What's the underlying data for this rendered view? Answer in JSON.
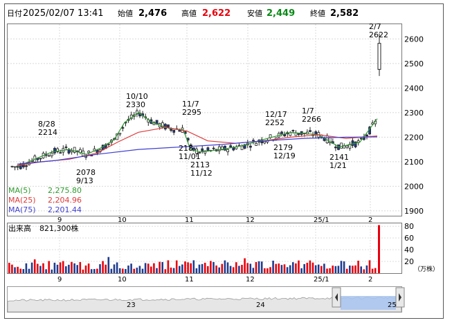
{
  "header": {
    "date_label": "日付",
    "datetime": "2025/02/07 13:41",
    "open_label": "始値",
    "open_value": "2,476",
    "high_label": "高値",
    "high_value": "2,622",
    "low_label": "安値",
    "low_value": "2,449",
    "close_label": "終値",
    "close_value": "2,582"
  },
  "colors": {
    "high": "#e8000b",
    "low": "#0a8a17",
    "up_candle": "#ffffff",
    "down_candle": "#1f3b8f",
    "ma5": "#2f9a2f",
    "ma25": "#e03a3a",
    "ma75": "#3f3fd0",
    "vol_up": "#e8000b",
    "vol_down": "#1f3b8f"
  },
  "legend": [
    {
      "name": "MA(5)",
      "value": "2,275.80",
      "color": "#2f9a2f"
    },
    {
      "name": "MA(25)",
      "value": "2,204.96",
      "color": "#e03a3a"
    },
    {
      "name": "MA(75)",
      "value": "2,201.44",
      "color": "#3f3fd0"
    }
  ],
  "chart_data": [
    {
      "type": "line",
      "name": "price",
      "ylim": [
        1880,
        2660
      ],
      "yticks": [
        "1900",
        "2000",
        "2100",
        "2200",
        "2300",
        "2400",
        "2500",
        "2600"
      ],
      "xticks": [
        "9",
        "10",
        "11",
        "12",
        "25/1",
        "2"
      ],
      "annotations": [
        {
          "date": "8/28",
          "value": "2214"
        },
        {
          "date": "9/13",
          "value": "2078"
        },
        {
          "date": "10/10",
          "value": "2330"
        },
        {
          "date": "11/7",
          "value": "2295"
        },
        {
          "date": "11/01",
          "value": "218"
        },
        {
          "date": "11/12",
          "value": "2113"
        },
        {
          "date": "12/17",
          "value": "2252"
        },
        {
          "date": "12/19",
          "value": "2179"
        },
        {
          "date": "1/7",
          "value": "2266"
        },
        {
          "date": "1/21",
          "value": "2141"
        },
        {
          "date": "2/7",
          "value": "2622"
        }
      ],
      "series": [
        {
          "name": "MA(5)",
          "x": [
            25,
            50,
            75,
            100,
            125,
            145,
            165,
            180,
            200,
            220,
            245,
            265,
            275,
            290,
            320,
            350,
            380,
            420,
            460,
            490,
            520,
            545
          ],
          "values": [
            2080,
            2110,
            2140,
            2150,
            2130,
            2155,
            2190,
            2260,
            2300,
            2260,
            2235,
            2230,
            2150,
            2140,
            2150,
            2165,
            2190,
            2220,
            2210,
            2160,
            2180,
            2275
          ]
        },
        {
          "name": "MA(25)",
          "x": [
            25,
            60,
            100,
            140,
            170,
            200,
            240,
            270,
            300,
            340,
            380,
            420,
            460,
            500,
            545
          ],
          "values": [
            2085,
            2100,
            2110,
            2135,
            2180,
            2220,
            2240,
            2225,
            2185,
            2175,
            2185,
            2200,
            2210,
            2195,
            2205
          ]
        },
        {
          "name": "MA(75)",
          "x": [
            25,
            80,
            140,
            200,
            260,
            320,
            380,
            440,
            500,
            545
          ],
          "values": [
            2090,
            2105,
            2130,
            2150,
            2160,
            2170,
            2185,
            2195,
            2200,
            2201
          ]
        }
      ]
    },
    {
      "type": "bar",
      "name": "volume",
      "title": "出来高",
      "value_label": "821,300株",
      "unit": "（万株）",
      "ylim": [
        0,
        85
      ],
      "yticks": [
        "20",
        "40",
        "60",
        "80"
      ],
      "xticks": [
        "9",
        "10",
        "11",
        "12",
        "25/1",
        "2"
      ]
    },
    {
      "type": "area",
      "name": "navigator",
      "labels": [
        "23",
        "24",
        "25"
      ]
    }
  ]
}
